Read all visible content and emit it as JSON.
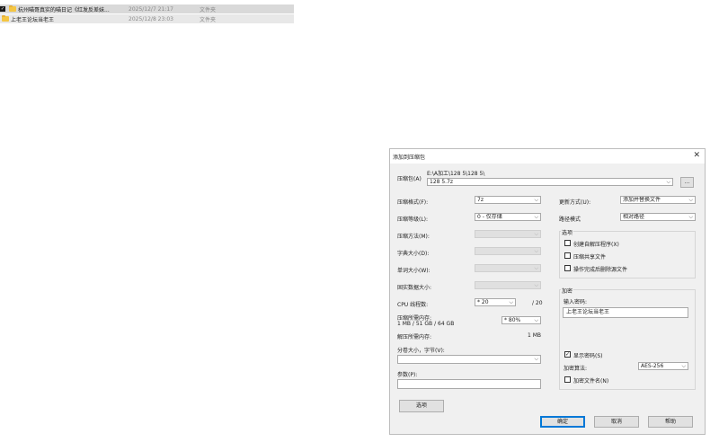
{
  "files": [
    {
      "name": "杭州喵哥真实的喵日记《红发反差妹...",
      "date": "2025/12/7 21:17",
      "type": "文件夹",
      "selected": true
    },
    {
      "name": "上老王论坛当老王",
      "date": "2025/12/8 23:03",
      "type": "文件夹",
      "selected": false
    }
  ],
  "dialog": {
    "title": "添加到压缩包",
    "close": "✕",
    "archive_label": "压缩包(A)",
    "archive_path": "E:\\A加工\\128 5\\128 5\\",
    "archive_name": "128 5.7z",
    "browse": "...",
    "format_label": "压缩格式(F):",
    "format_value": "7z",
    "level_label": "压缩等级(L):",
    "level_value": "0 - 仅存储",
    "method_label": "压缩方法(M):",
    "dict_label": "字典大小(D):",
    "word_label": "单词大小(W):",
    "solid_label": "固实数据大小:",
    "cpu_label": "CPU 线程数:",
    "cpu_value": "* 20",
    "cpu_total": "/ 20",
    "mem_label": "压缩所需内存:",
    "mem_detail": "1 MB / 51 GB / 64 GB",
    "mem_value": "* 80%",
    "decomp_label": "解压所需内存:",
    "decomp_value": "1 MB",
    "split_label": "分卷大小，字节(V):",
    "params_label": "参数(P):",
    "options_button": "选项",
    "update_label": "更新方式(U):",
    "update_value": "添加并替换文件",
    "path_label": "路径模式",
    "path_value": "相对路径",
    "options_group": "选项",
    "opt_sfx": "创建自解压程序(X)",
    "opt_shared": "压缩共享文件",
    "opt_delete": "操作完成后删除源文件",
    "encrypt_group": "加密",
    "password_label": "输入密码:",
    "password_value": "上老王论坛当老王",
    "show_password": "显示密码(S)",
    "check_mark": "✓",
    "enc_method_label": "加密算法:",
    "enc_method_value": "AES-256",
    "encrypt_names": "加密文件名(N)",
    "ok": "确定",
    "cancel": "取消",
    "help": "帮助",
    "chevron": "⌵"
  }
}
